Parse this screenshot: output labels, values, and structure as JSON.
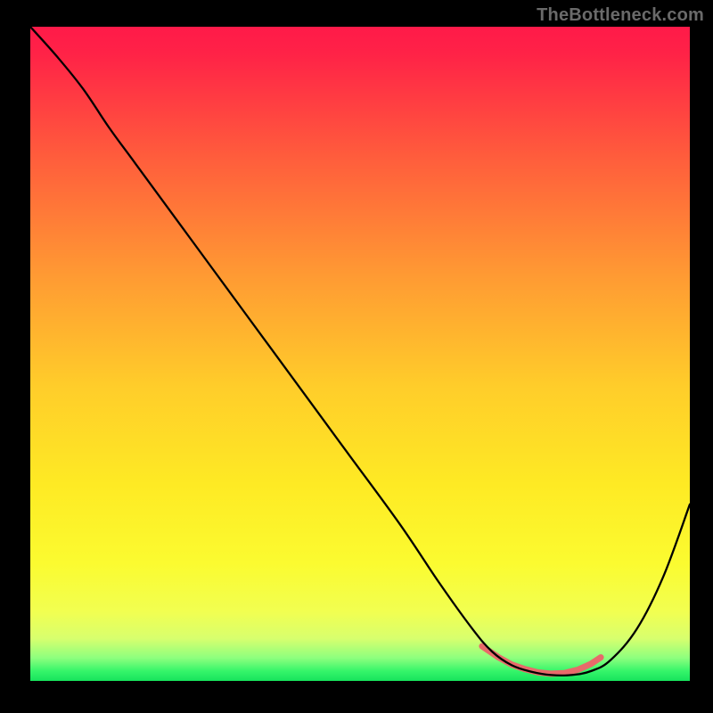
{
  "watermark": "TheBottleneck.com",
  "plot": {
    "background_stops": [
      {
        "offset": 0,
        "color": "#ff1a49"
      },
      {
        "offset": 0.04,
        "color": "#ff2247"
      },
      {
        "offset": 0.2,
        "color": "#ff5d3c"
      },
      {
        "offset": 0.38,
        "color": "#ff9a33"
      },
      {
        "offset": 0.55,
        "color": "#ffcd2a"
      },
      {
        "offset": 0.7,
        "color": "#feea24"
      },
      {
        "offset": 0.82,
        "color": "#fbfb30"
      },
      {
        "offset": 0.895,
        "color": "#f1ff51"
      },
      {
        "offset": 0.935,
        "color": "#d8ff6e"
      },
      {
        "offset": 0.965,
        "color": "#8dff7e"
      },
      {
        "offset": 0.985,
        "color": "#35f56a"
      },
      {
        "offset": 1.0,
        "color": "#17e35c"
      }
    ],
    "line_color": "#000000",
    "line_width": 2.3,
    "accent_color": "#e86a6a",
    "accent_width": 7
  },
  "chart_data": {
    "type": "line",
    "title": "",
    "xlabel": "",
    "ylabel": "",
    "xlim": [
      0,
      100
    ],
    "ylim": [
      0,
      100
    ],
    "grid": false,
    "series": [
      {
        "name": "bottleneck-curve",
        "x": [
          0,
          4,
          8,
          12,
          16,
          24,
          32,
          40,
          48,
          56,
          62,
          67,
          70,
          73,
          76,
          79,
          82,
          85,
          88,
          92,
          96,
          100
        ],
        "y": [
          100,
          95.5,
          90.5,
          84.5,
          79,
          68,
          57,
          46,
          35,
          24,
          15,
          8,
          4.5,
          2.4,
          1.4,
          0.9,
          0.9,
          1.5,
          3.2,
          8,
          16,
          27
        ]
      }
    ],
    "accent_segment": {
      "name": "near-zero-band",
      "x": [
        68.5,
        71,
        73,
        75,
        77,
        79,
        81,
        83,
        85,
        86.5
      ],
      "y": [
        5.3,
        3.6,
        2.5,
        1.8,
        1.3,
        1.1,
        1.2,
        1.7,
        2.6,
        3.6
      ]
    }
  }
}
